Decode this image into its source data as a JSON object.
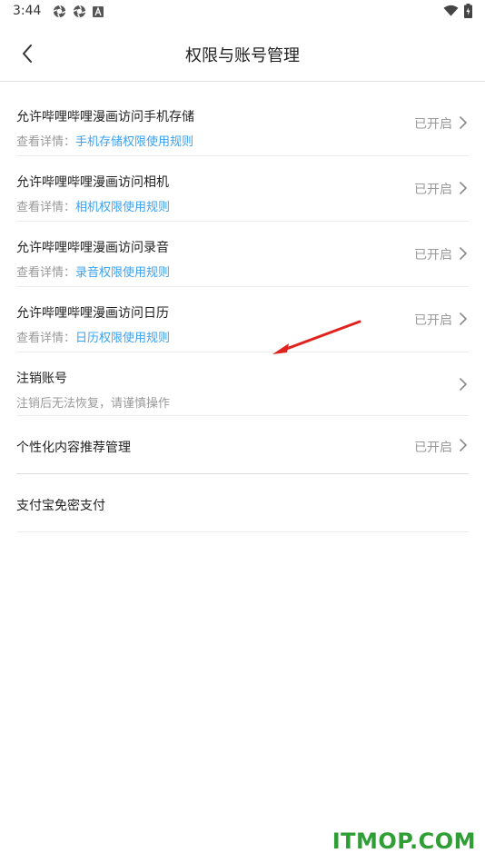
{
  "status_bar": {
    "time": "3:44",
    "left_icons": [
      "gear-icon",
      "gear-icon",
      "notification-a-icon"
    ],
    "right_icons": [
      "wifi-icon",
      "battery-charging-icon"
    ]
  },
  "header": {
    "title": "权限与账号管理",
    "back_icon": "chevron-left-icon"
  },
  "permissions": [
    {
      "title": "允许哔哩哔哩漫画访问手机存储",
      "sub_prefix": "查看详情：",
      "sub_link": "手机存储权限使用规则",
      "status": "已开启"
    },
    {
      "title": "允许哔哩哔哩漫画访问相机",
      "sub_prefix": "查看详情：",
      "sub_link": "相机权限使用规则",
      "status": "已开启"
    },
    {
      "title": "允许哔哩哔哩漫画访问录音",
      "sub_prefix": "查看详情：",
      "sub_link": "录音权限使用规则",
      "status": "已开启"
    },
    {
      "title": "允许哔哩哔哩漫画访问日历",
      "sub_prefix": "查看详情：",
      "sub_link": "日历权限使用规则",
      "status": "已开启"
    }
  ],
  "cancel_account": {
    "title": "注销账号",
    "subtitle": "注销后无法恢复，请谨慎操作"
  },
  "personalization": {
    "title": "个性化内容推荐管理",
    "status": "已开启"
  },
  "alipay": {
    "title": "支付宝免密支付"
  },
  "colors": {
    "link": "#3aa1f0",
    "annotation_arrow": "#e0231c",
    "watermark": "#2e9e35"
  },
  "watermark": "ITMOP.COM"
}
